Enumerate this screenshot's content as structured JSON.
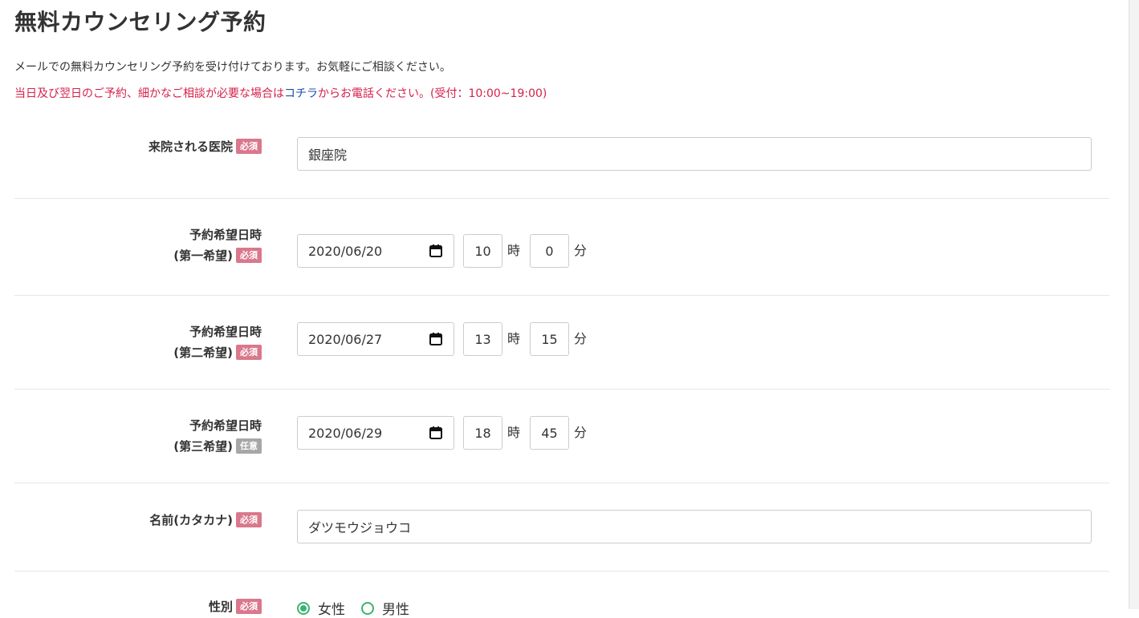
{
  "page": {
    "title": "無料カウンセリング予約",
    "intro": "メールでの無料カウンセリング予約を受け付けております。お気軽にご相談ください。",
    "notice_before": "当日及び翌日のご予約、細かなご相談が必要な場合は",
    "notice_link": "コチラ",
    "notice_after": "からお電話ください。(受付：10:00~19:00)"
  },
  "badges": {
    "required": "必須",
    "optional": "任意"
  },
  "units": {
    "hour": "時",
    "minute": "分"
  },
  "clinic": {
    "label": "来院される医院",
    "value": "銀座院"
  },
  "choice1": {
    "label_line1": "予約希望日時",
    "label_line2": "(第一希望)",
    "date": "2020/06/20",
    "hour": "10",
    "minute": "0"
  },
  "choice2": {
    "label_line1": "予約希望日時",
    "label_line2": "(第二希望)",
    "date": "2020/06/27",
    "hour": "13",
    "minute": "15"
  },
  "choice3": {
    "label_line1": "予約希望日時",
    "label_line2": "(第三希望)",
    "date": "2020/06/29",
    "hour": "18",
    "minute": "45"
  },
  "name_kana": {
    "label": "名前(カタカナ)",
    "value": "ダツモウジョウコ"
  },
  "gender": {
    "label": "性別",
    "options": [
      "女性",
      "男性"
    ],
    "selected": "女性"
  },
  "icons": {
    "calendar": "calendar-icon",
    "radio": "radio-button"
  },
  "colors": {
    "notice": "#d6204a",
    "link": "#1a4fa8",
    "required_badge": "#d9788c",
    "optional_badge": "#a7a7a7",
    "radio": "#3cb371"
  }
}
